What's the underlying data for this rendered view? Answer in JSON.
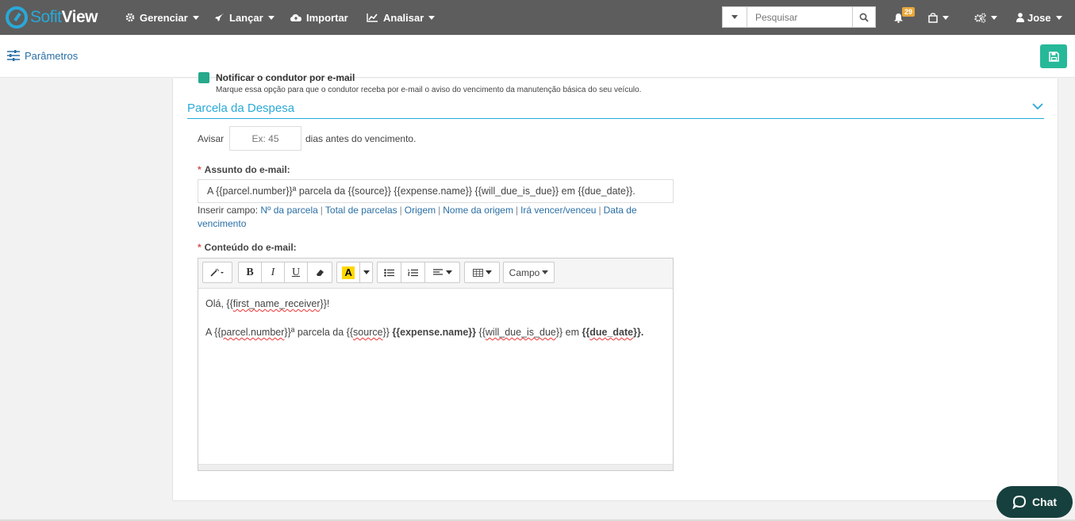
{
  "brand": {
    "part1": "Sofit",
    "part2": "View"
  },
  "nav": {
    "gerenciar": "Gerenciar",
    "lancar": "Lançar",
    "importar": "Importar",
    "analisar": "Analisar",
    "user": "Jose"
  },
  "search": {
    "placeholder": "Pesquisar"
  },
  "notifications": {
    "count": "29"
  },
  "subbar": {
    "parametros": "Parâmetros"
  },
  "form": {
    "notify_label": "Notificar o condutor por e-mail",
    "notify_help": "Marque essa opção para que o condutor receba por e-mail o aviso do vencimento da manutenção básica do seu veículo.",
    "section_title": "Parcela da Despesa",
    "avisar_label": "Avisar",
    "avisar_placeholder": "Ex: 45",
    "dias_text": "dias antes do vencimento.",
    "assunto_label": "Assunto do e-mail:",
    "assunto_value": "A {{parcel.number}}ª parcela da {{source}} {{expense.name}} {{will_due_is_due}} em {{due_date}}.",
    "inserir_label": "Inserir campo:",
    "inserir_links": [
      "Nº da parcela",
      "Total de parcelas",
      "Origem",
      "Nome da origem",
      "Irá vencer/venceu",
      "Data de vencimento"
    ],
    "conteudo_label": "Conteúdo do e-mail:"
  },
  "editor": {
    "campo_label": "Campo",
    "line1_pre": "Olá, {{",
    "line1_field": "first_name_receiver",
    "line1_post": "}}!",
    "l2_a": "A {{",
    "l2_b": "parcel.number",
    "l2_c": "}}ª parcela da {{",
    "l2_d": "source",
    "l2_e": "}}",
    "l2_f": "{{expense.name}}",
    "l2_g": "{{",
    "l2_h": "will_due_is_due",
    "l2_i": "}} em",
    "l2_j": "{{",
    "l2_k": "due_date",
    "l2_l": "}}."
  },
  "chat": {
    "label": "Chat"
  }
}
